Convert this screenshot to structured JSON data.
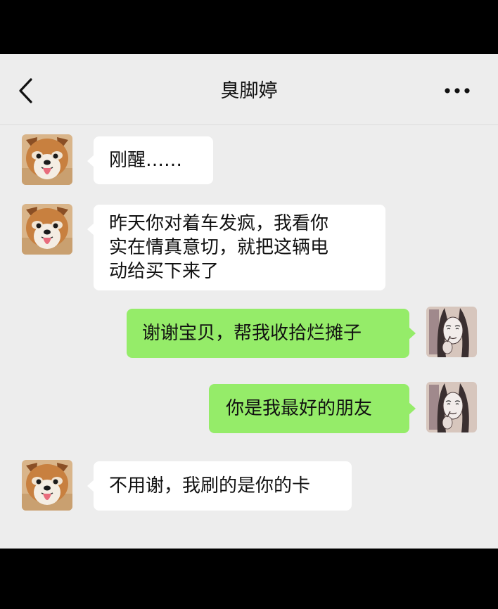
{
  "header": {
    "title": "臭脚婷",
    "back_icon": "chevron-left-icon",
    "more_icon": "more-dots-icon"
  },
  "messages": [
    {
      "side": "left",
      "avatar": "dog-avatar",
      "lines": [
        "刚醒……"
      ]
    },
    {
      "side": "left",
      "avatar": "dog-avatar",
      "lines": [
        "昨天你对着车发疯，我看你",
        "实在情真意切，就把这辆电",
        "动给买下来了"
      ]
    },
    {
      "side": "right",
      "avatar": "woman-sketch-avatar",
      "lines": [
        "谢谢宝贝，帮我收拾烂摊子"
      ]
    },
    {
      "side": "right",
      "avatar": "woman-sketch-avatar",
      "lines": [
        "你是我最好的朋友"
      ]
    },
    {
      "side": "left",
      "avatar": "dog-avatar",
      "lines": [
        "不用谢，我刷的是你的卡"
      ]
    }
  ],
  "colors": {
    "background": "#ededed",
    "bubble_left": "#ffffff",
    "bubble_right": "#95ec69",
    "frame": "#000000"
  }
}
